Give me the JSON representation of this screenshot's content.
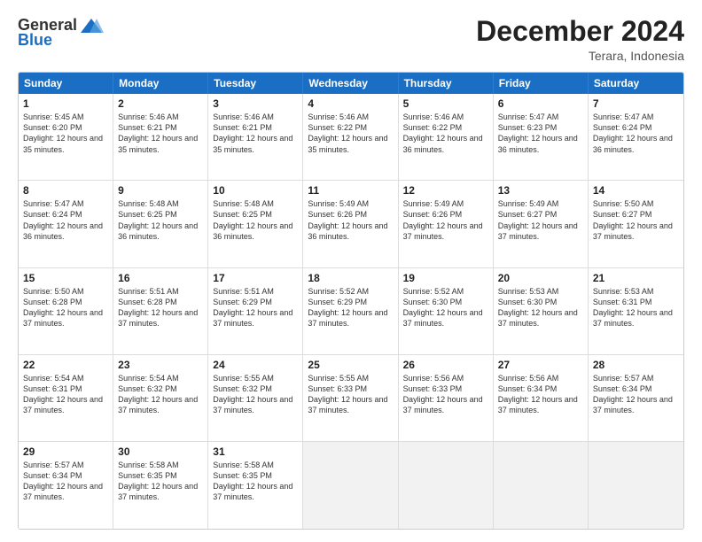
{
  "header": {
    "logo_general": "General",
    "logo_blue": "Blue",
    "month_title": "December 2024",
    "location": "Terara, Indonesia"
  },
  "days_of_week": [
    "Sunday",
    "Monday",
    "Tuesday",
    "Wednesday",
    "Thursday",
    "Friday",
    "Saturday"
  ],
  "rows": [
    [
      {
        "day": "1",
        "sunrise": "5:45 AM",
        "sunset": "6:20 PM",
        "daylight": "12 hours and 35 minutes."
      },
      {
        "day": "2",
        "sunrise": "5:46 AM",
        "sunset": "6:21 PM",
        "daylight": "12 hours and 35 minutes."
      },
      {
        "day": "3",
        "sunrise": "5:46 AM",
        "sunset": "6:21 PM",
        "daylight": "12 hours and 35 minutes."
      },
      {
        "day": "4",
        "sunrise": "5:46 AM",
        "sunset": "6:22 PM",
        "daylight": "12 hours and 35 minutes."
      },
      {
        "day": "5",
        "sunrise": "5:46 AM",
        "sunset": "6:22 PM",
        "daylight": "12 hours and 36 minutes."
      },
      {
        "day": "6",
        "sunrise": "5:47 AM",
        "sunset": "6:23 PM",
        "daylight": "12 hours and 36 minutes."
      },
      {
        "day": "7",
        "sunrise": "5:47 AM",
        "sunset": "6:24 PM",
        "daylight": "12 hours and 36 minutes."
      }
    ],
    [
      {
        "day": "8",
        "sunrise": "5:47 AM",
        "sunset": "6:24 PM",
        "daylight": "12 hours and 36 minutes."
      },
      {
        "day": "9",
        "sunrise": "5:48 AM",
        "sunset": "6:25 PM",
        "daylight": "12 hours and 36 minutes."
      },
      {
        "day": "10",
        "sunrise": "5:48 AM",
        "sunset": "6:25 PM",
        "daylight": "12 hours and 36 minutes."
      },
      {
        "day": "11",
        "sunrise": "5:49 AM",
        "sunset": "6:26 PM",
        "daylight": "12 hours and 36 minutes."
      },
      {
        "day": "12",
        "sunrise": "5:49 AM",
        "sunset": "6:26 PM",
        "daylight": "12 hours and 37 minutes."
      },
      {
        "day": "13",
        "sunrise": "5:49 AM",
        "sunset": "6:27 PM",
        "daylight": "12 hours and 37 minutes."
      },
      {
        "day": "14",
        "sunrise": "5:50 AM",
        "sunset": "6:27 PM",
        "daylight": "12 hours and 37 minutes."
      }
    ],
    [
      {
        "day": "15",
        "sunrise": "5:50 AM",
        "sunset": "6:28 PM",
        "daylight": "12 hours and 37 minutes."
      },
      {
        "day": "16",
        "sunrise": "5:51 AM",
        "sunset": "6:28 PM",
        "daylight": "12 hours and 37 minutes."
      },
      {
        "day": "17",
        "sunrise": "5:51 AM",
        "sunset": "6:29 PM",
        "daylight": "12 hours and 37 minutes."
      },
      {
        "day": "18",
        "sunrise": "5:52 AM",
        "sunset": "6:29 PM",
        "daylight": "12 hours and 37 minutes."
      },
      {
        "day": "19",
        "sunrise": "5:52 AM",
        "sunset": "6:30 PM",
        "daylight": "12 hours and 37 minutes."
      },
      {
        "day": "20",
        "sunrise": "5:53 AM",
        "sunset": "6:30 PM",
        "daylight": "12 hours and 37 minutes."
      },
      {
        "day": "21",
        "sunrise": "5:53 AM",
        "sunset": "6:31 PM",
        "daylight": "12 hours and 37 minutes."
      }
    ],
    [
      {
        "day": "22",
        "sunrise": "5:54 AM",
        "sunset": "6:31 PM",
        "daylight": "12 hours and 37 minutes."
      },
      {
        "day": "23",
        "sunrise": "5:54 AM",
        "sunset": "6:32 PM",
        "daylight": "12 hours and 37 minutes."
      },
      {
        "day": "24",
        "sunrise": "5:55 AM",
        "sunset": "6:32 PM",
        "daylight": "12 hours and 37 minutes."
      },
      {
        "day": "25",
        "sunrise": "5:55 AM",
        "sunset": "6:33 PM",
        "daylight": "12 hours and 37 minutes."
      },
      {
        "day": "26",
        "sunrise": "5:56 AM",
        "sunset": "6:33 PM",
        "daylight": "12 hours and 37 minutes."
      },
      {
        "day": "27",
        "sunrise": "5:56 AM",
        "sunset": "6:34 PM",
        "daylight": "12 hours and 37 minutes."
      },
      {
        "day": "28",
        "sunrise": "5:57 AM",
        "sunset": "6:34 PM",
        "daylight": "12 hours and 37 minutes."
      }
    ],
    [
      {
        "day": "29",
        "sunrise": "5:57 AM",
        "sunset": "6:34 PM",
        "daylight": "12 hours and 37 minutes."
      },
      {
        "day": "30",
        "sunrise": "5:58 AM",
        "sunset": "6:35 PM",
        "daylight": "12 hours and 37 minutes."
      },
      {
        "day": "31",
        "sunrise": "5:58 AM",
        "sunset": "6:35 PM",
        "daylight": "12 hours and 37 minutes."
      },
      null,
      null,
      null,
      null
    ]
  ],
  "labels": {
    "sunrise_prefix": "Sunrise: ",
    "sunset_prefix": "Sunset: ",
    "daylight_prefix": "Daylight: "
  }
}
